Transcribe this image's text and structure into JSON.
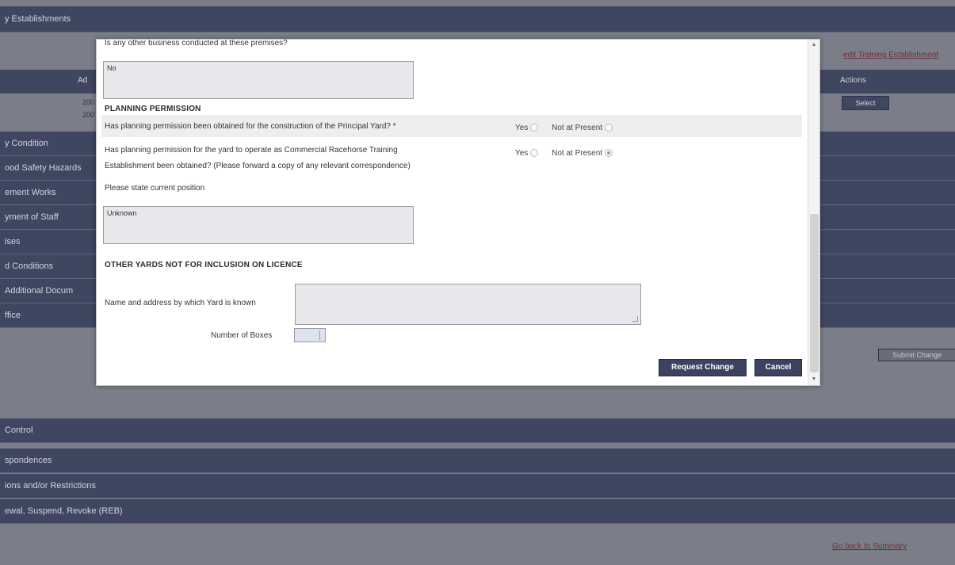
{
  "background": {
    "header_title": "y Establishments",
    "top_link": "edit Training Establishment",
    "table_headers": {
      "col_left": "",
      "col_ad": "Ad",
      "col_actions": "Actions"
    },
    "row_values": [
      "200",
      "200"
    ],
    "select_label": "Select",
    "sections": [
      "y Condition",
      "ood Safety Hazards",
      "ement Works",
      "yment of Staff",
      "ises",
      "d Conditions",
      "Additional Docum",
      "ffice"
    ],
    "right_button": "Submit Change",
    "lower_sections": [
      "Control",
      "spondences",
      "ions and/or Restrictions",
      "ewal, Suspend, Revoke (REB)"
    ],
    "bottom_link": "Go back to Summary"
  },
  "modal": {
    "top_question": "Is any other business conducted at these premises?",
    "top_answer": "No",
    "planning": {
      "heading": "PLANNING PERMISSION",
      "q1": "Has planning permission been obtained for the construction of the Principal Yard? *",
      "q1_yes": "Yes",
      "q1_np": "Not at Present",
      "q2_line1": "Has planning permission for the yard to operate as Commercial Racehorse Training",
      "q2_line2": "Establishment been obtained? (Please forward a copy of any relevant correspondence)",
      "q2_yes": "Yes",
      "q2_np": "Not at Present",
      "state_label": "Please state current position",
      "state_value": "Unknown"
    },
    "other_yards": {
      "heading": "OTHER YARDS NOT FOR INCLUSION ON LICENCE",
      "name_label": "Name and address by which Yard is known",
      "name_value": "",
      "boxes_label": "Number of Boxes",
      "boxes_value": ""
    },
    "buttons": {
      "request": "Request Change",
      "cancel": "Cancel"
    }
  }
}
